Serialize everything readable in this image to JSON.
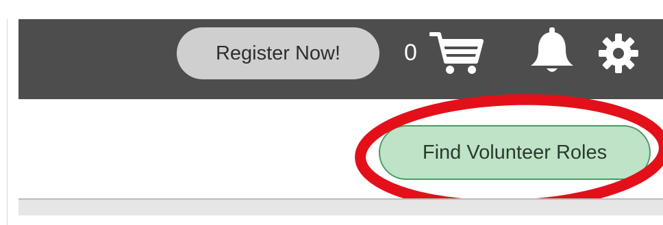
{
  "header": {
    "register_label": "Register Now!",
    "cart_count": "0",
    "icons": {
      "cart": "shopping-cart-icon",
      "bell": "notifications-bell-icon",
      "gear": "settings-gear-icon"
    },
    "background_color": "#4d4d4d"
  },
  "main": {
    "find_volunteer_label": "Find Volunteer Roles",
    "find_button_color": "#bfe3c7"
  },
  "annotation": {
    "highlight_color": "#e3101a"
  }
}
